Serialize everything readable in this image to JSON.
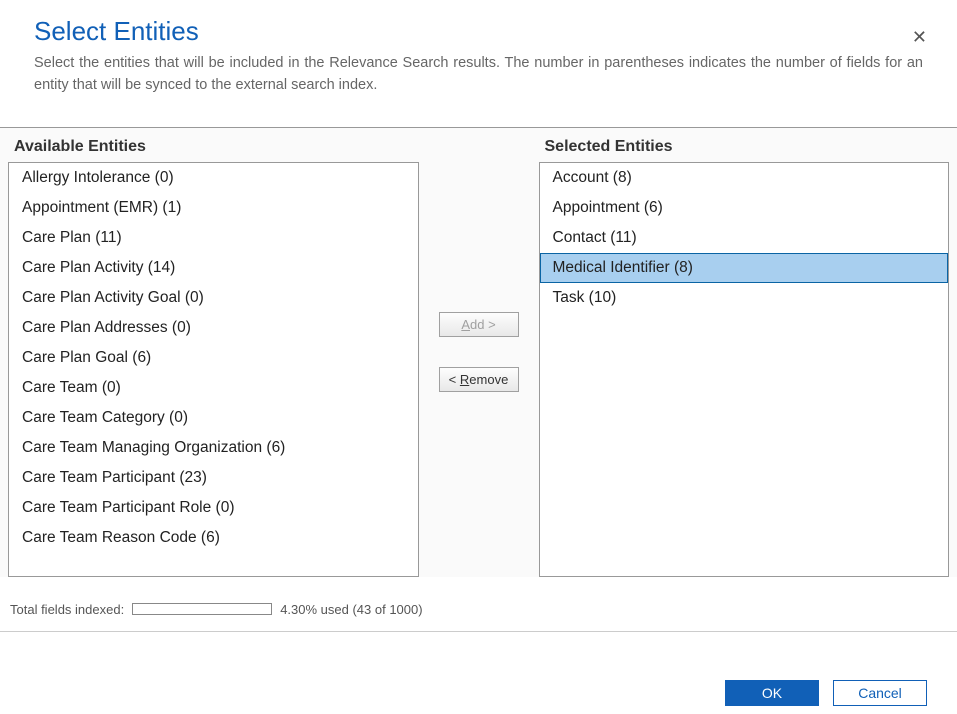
{
  "header": {
    "title": "Select Entities",
    "description": "Select the entities that will be included in the Relevance Search results. The number in parentheses indicates the number of fields for an entity that will be synced to the external search index.",
    "close": "✕"
  },
  "available": {
    "label": "Available Entities",
    "items": [
      "Allergy Intolerance (0)",
      "Appointment (EMR) (1)",
      "Care Plan (11)",
      "Care Plan Activity (14)",
      "Care Plan Activity Goal (0)",
      "Care Plan Addresses (0)",
      "Care Plan Goal (6)",
      "Care Team (0)",
      "Care Team Category (0)",
      "Care Team Managing Organization (6)",
      "Care Team Participant (23)",
      "Care Team Participant Role (0)",
      "Care Team Reason Code (6)"
    ]
  },
  "selected": {
    "label": "Selected Entities",
    "items": [
      "Account (8)",
      "Appointment (6)",
      "Contact (11)",
      "Medical Identifier (8)",
      "Task (10)"
    ],
    "highlighted_index": 3
  },
  "buttons": {
    "add": "Add >",
    "remove": "< Remove",
    "ok": "OK",
    "cancel": "Cancel"
  },
  "status": {
    "label": "Total fields indexed:",
    "usage_text": "4.30% used (43 of 1000)",
    "percent": 4.3
  }
}
